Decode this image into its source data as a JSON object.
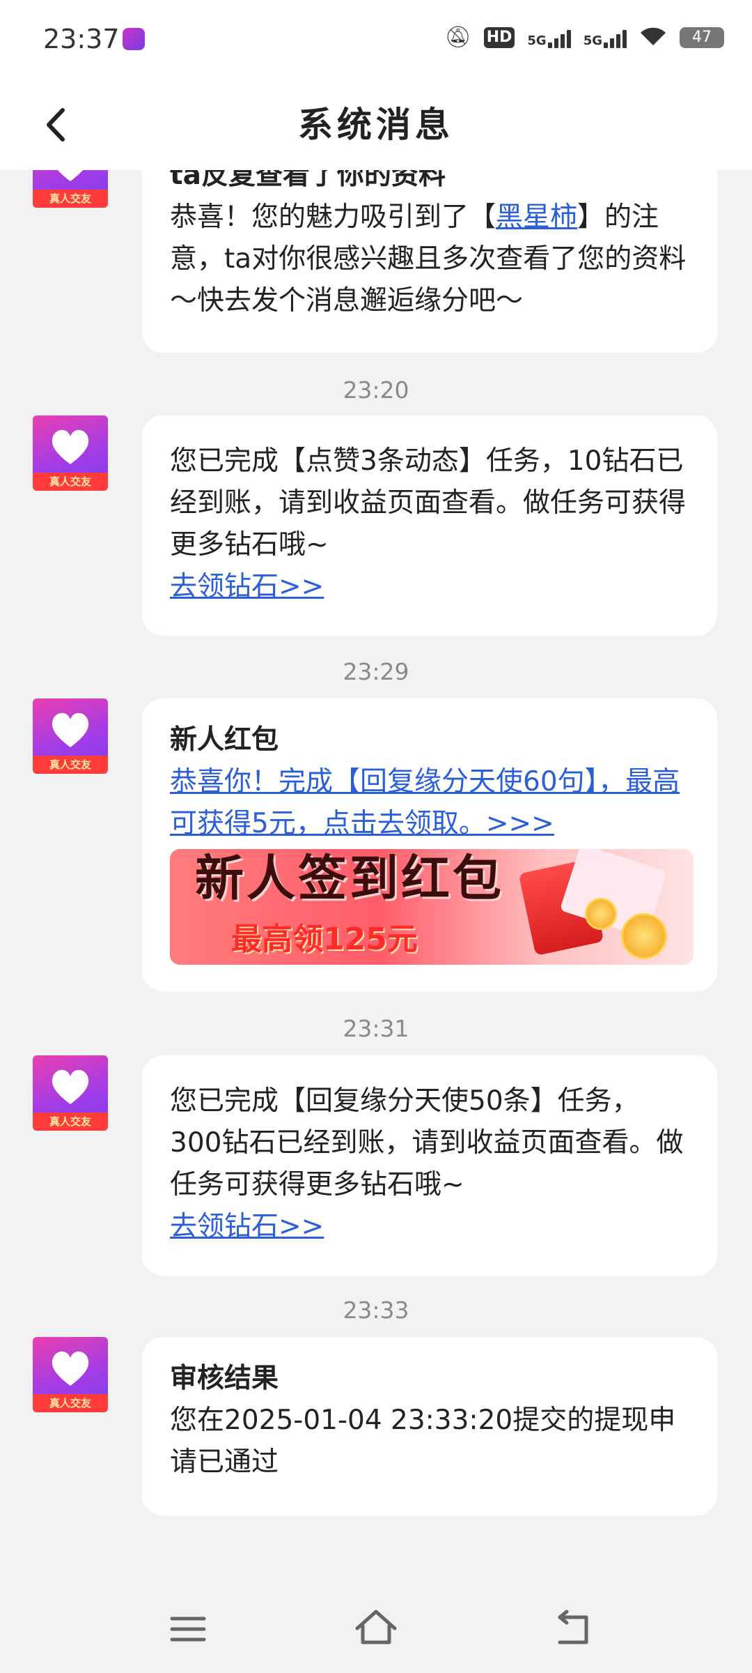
{
  "status_bar": {
    "time": "23:37",
    "hd_label": "HD",
    "net1": "5G",
    "net2": "5G",
    "battery": "47"
  },
  "header": {
    "title": "系统消息"
  },
  "messages": [
    {
      "title": "ta反复查看了你的资料",
      "text_before": "恭喜！您的魅力吸引到了【",
      "link_name": "黑星柿",
      "text_after": "】的注意，ta对你很感兴趣且多次查看了您的资料～快去发个消息邂逅缘分吧～"
    },
    {
      "time": "23:20",
      "text": "您已完成【点赞3条动态】任务，10钻石已经到账，请到收益页面查看。做任务可获得更多钻石哦~",
      "link": "去领钻石>>"
    },
    {
      "time": "23:29",
      "title": "新人红包",
      "link": "恭喜你！完成【回复缘分天使60句】，最高可获得5元，点击去领取。>>>",
      "banner_line1": "新人签到红包",
      "banner_line2": "最高领125元"
    },
    {
      "time": "23:31",
      "text": "您已完成【回复缘分天使50条】任务，300钻石已经到账，请到收益页面查看。做任务可获得更多钻石哦~",
      "link": "去领钻石>>"
    },
    {
      "time": "23:33",
      "title": "审核结果",
      "text": "您在2025-01-04 23:33:20提交的提现申请已通过"
    }
  ],
  "avatar_tag": "真人交友"
}
